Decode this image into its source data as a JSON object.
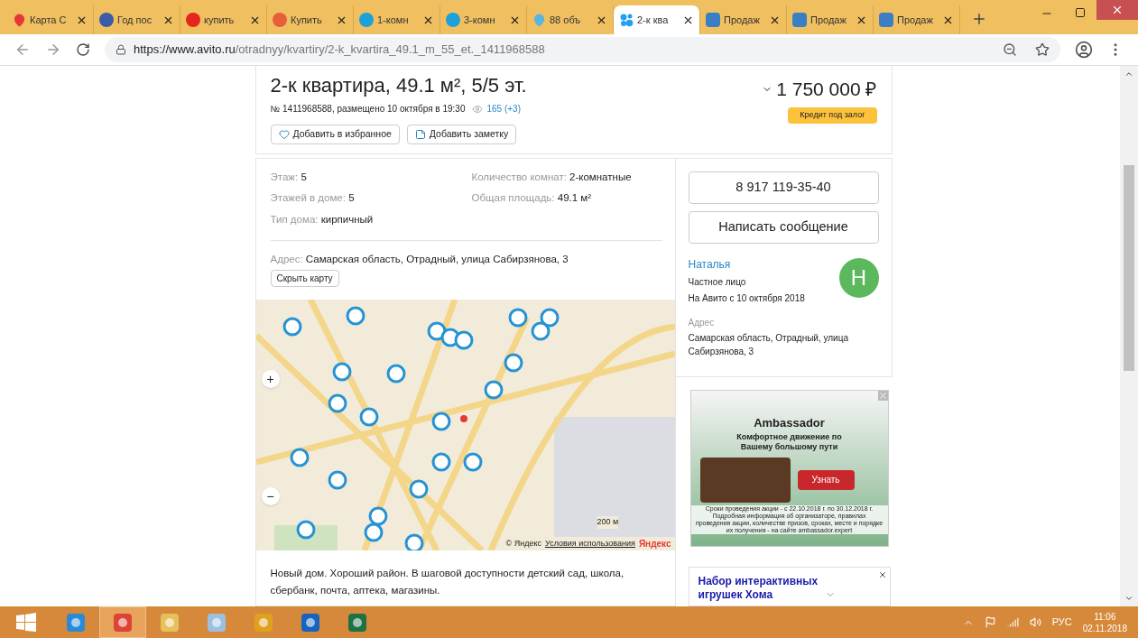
{
  "browser": {
    "tabs": [
      {
        "title": "Карта С",
        "selected": false
      },
      {
        "title": "Год пос",
        "selected": false
      },
      {
        "title": "купить",
        "selected": false
      },
      {
        "title": "Купить",
        "selected": false
      },
      {
        "title": "1-комн",
        "selected": false
      },
      {
        "title": "3-комн",
        "selected": false
      },
      {
        "title": "88 объ",
        "selected": false
      },
      {
        "title": "2-к ква",
        "selected": true
      },
      {
        "title": "Продаж",
        "selected": false
      },
      {
        "title": "Продаж",
        "selected": false
      },
      {
        "title": "Продаж",
        "selected": false
      }
    ],
    "url_host": "https://www.avito.ru",
    "url_path": "/otradnyy/kvartiry/2-k_kvartira_49.1_m_55_et._1411968588"
  },
  "listing": {
    "title": "2-к квартира, 49.1 м², 5/5 эт.",
    "meta": "№ 1411968588, размещено 10 октября в 19:30",
    "views": "165",
    "views_new": "(+3)",
    "price": "1 750 000 ₽",
    "credit_button": "Кредит под залог",
    "favorite_button": "Добавить в избранное",
    "note_button": "Добавить заметку",
    "params_left": [
      {
        "label": "Этаж:",
        "value": "5"
      },
      {
        "label": "Этажей в доме:",
        "value": "5"
      },
      {
        "label": "Тип дома:",
        "value": "кирпичный"
      }
    ],
    "params_right": [
      {
        "label": "Количество комнат:",
        "value": "2-комнатные"
      },
      {
        "label": "Общая площадь:",
        "value": "49.1 м²"
      }
    ],
    "address_label": "Адрес:",
    "address": "Самарская область, Отрадный, улица Сабирзянова, 3",
    "hide_map_button": "Скрыть карту",
    "map": {
      "zoom_in": "+",
      "zoom_out": "−",
      "scale": "200 м",
      "copyright": "© Яндекс",
      "terms": "Условия использования",
      "logo": "Яндекс"
    },
    "description": "Новый дом. Хороший район. В шаговой доступности детский сад, школа, сбербанк, почта, аптека, магазины."
  },
  "seller": {
    "phone": "8 917 119-35-40",
    "message_button": "Написать сообщение",
    "name": "Наталья",
    "type": "Частное лицо",
    "since": "На Авито с 10 октября 2018",
    "avatar_letter": "Н",
    "address_label": "Адрес",
    "address": "Самарская область, Отрадный, улица Сабирзянова, 3"
  },
  "ad": {
    "brand": "Ambassador",
    "headline": "Комфортное движение по Вашему большому пути",
    "button": "Узнать",
    "fine_print": "Сроки проведения акции - с 22.10.2018 г. по 30.12.2018 г. Подробная информация об организаторе, правилах проведения акции, количестве призов, сроках, месте и порядке их получения - на сайте ambassador.expert"
  },
  "ad2": {
    "title": "Набор интерактивных игрушек Хома"
  },
  "taskbar": {
    "apps": [
      {
        "kind": "ie",
        "selected": false
      },
      {
        "kind": "chrome",
        "selected": true
      },
      {
        "kind": "explorer",
        "selected": false
      },
      {
        "kind": "paint",
        "selected": false
      },
      {
        "kind": "chart",
        "selected": false
      },
      {
        "kind": "outlook",
        "selected": false
      },
      {
        "kind": "excel",
        "selected": false
      }
    ],
    "language": "РУС",
    "time": "11:06",
    "date": "02.11.2018"
  }
}
